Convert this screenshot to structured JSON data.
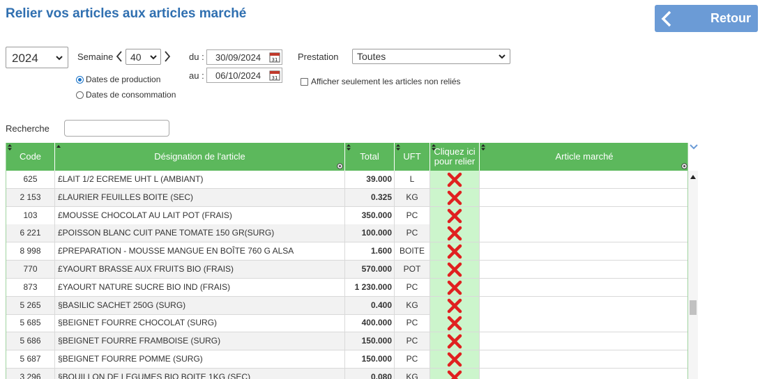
{
  "header": {
    "title": "Relier vos articles aux articles marché",
    "back_label": "Retour"
  },
  "filters": {
    "year": "2024",
    "week_label": "Semaine",
    "week": "40",
    "du_label": "du :",
    "au_label": "au :",
    "date_from": "30/09/2024",
    "date_to": "06/10/2024",
    "prestation_label": "Prestation",
    "prestation": "Toutes",
    "radio_production": "Dates de production",
    "radio_consommation": "Dates de consommation",
    "only_unlinked": "Afficher seulement les articles non reliés",
    "search_label": "Recherche",
    "search_value": ""
  },
  "colors": {
    "accent": "#2f6fb0",
    "header_green": "#5cb85c",
    "link_bg": "#ccf5cc",
    "cross": "#e02020"
  },
  "table": {
    "columns": [
      "Code",
      "Désignation de l'article",
      "Total",
      "UFT",
      "Cliquez ici pour relier",
      "Article marché"
    ],
    "rows": [
      {
        "code": "625",
        "designation": "£LAIT 1/2 ECREME UHT L (AMBIANT)",
        "total": "39.000",
        "uft": "L",
        "article_marche": ""
      },
      {
        "code": "2 153",
        "designation": "£LAURIER FEUILLES BOITE (SEC)",
        "total": "0.325",
        "uft": "KG",
        "article_marche": ""
      },
      {
        "code": "103",
        "designation": "£MOUSSE CHOCOLAT AU LAIT POT (FRAIS)",
        "total": "350.000",
        "uft": "PC",
        "article_marche": ""
      },
      {
        "code": "6 221",
        "designation": "£POISSON BLANC CUIT PANE TOMATE 150 GR(SURG)",
        "total": "100.000",
        "uft": "PC",
        "article_marche": ""
      },
      {
        "code": "8 998",
        "designation": "£PREPARATION - MOUSSE MANGUE EN BOÎTE 760 G ALSA",
        "total": "1.600",
        "uft": "BOITE",
        "article_marche": ""
      },
      {
        "code": "770",
        "designation": "£YAOURT BRASSE AUX FRUITS BIO (FRAIS)",
        "total": "570.000",
        "uft": "POT",
        "article_marche": ""
      },
      {
        "code": "873",
        "designation": "£YAOURT NATURE SUCRE BIO IND (FRAIS)",
        "total": "1 230.000",
        "uft": "PC",
        "article_marche": ""
      },
      {
        "code": "5 265",
        "designation": "§BASILIC SACHET 250G (SURG)",
        "total": "0.400",
        "uft": "KG",
        "article_marche": ""
      },
      {
        "code": "5 685",
        "designation": "§BEIGNET FOURRE CHOCOLAT (SURG)",
        "total": "400.000",
        "uft": "PC",
        "article_marche": ""
      },
      {
        "code": "5 686",
        "designation": "§BEIGNET FOURRE FRAMBOISE (SURG)",
        "total": "150.000",
        "uft": "PC",
        "article_marche": ""
      },
      {
        "code": "5 687",
        "designation": "§BEIGNET FOURRE POMME (SURG)",
        "total": "150.000",
        "uft": "PC",
        "article_marche": ""
      },
      {
        "code": "3 296",
        "designation": "§BOUILLON DE LEGUMES BIO BOITE 1KG (SEC)",
        "total": "0.080",
        "uft": "KG",
        "article_marche": ""
      }
    ]
  }
}
